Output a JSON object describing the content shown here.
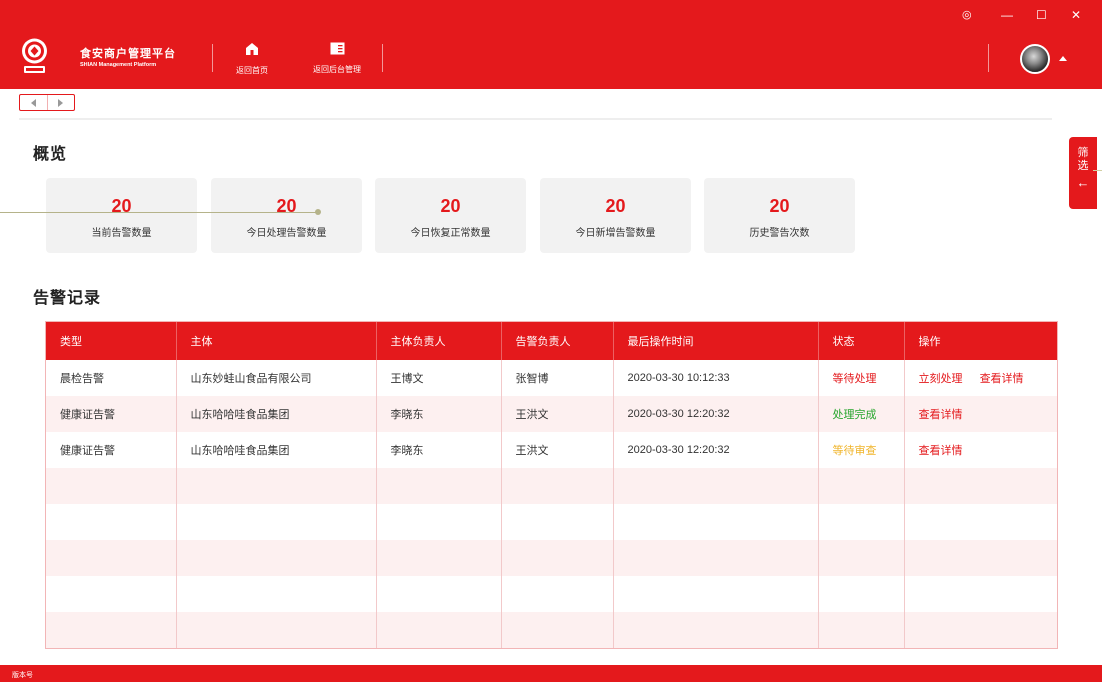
{
  "app": {
    "brand_cn": "食安商户管理平台",
    "brand_en": "SHIAN Management Platform",
    "brand_color": "#e4191c"
  },
  "nav": {
    "home_label": "返回首页",
    "home_icon": "home-icon",
    "admin_label": "返回后台管理",
    "admin_icon": "panel-icon"
  },
  "window": {
    "settings_icon": "◎",
    "minimize_icon": "—",
    "maximize_icon": "☐",
    "close_icon": "✕"
  },
  "overview": {
    "title": "概览",
    "cards": [
      {
        "value": "20",
        "label": "当前告警数量"
      },
      {
        "value": "20",
        "label": "今日处理告警数量"
      },
      {
        "value": "20",
        "label": "今日恢复正常数量"
      },
      {
        "value": "20",
        "label": "今日新增告警数量"
      },
      {
        "value": "20",
        "label": "历史警告次数"
      }
    ]
  },
  "filter": {
    "label": "筛选",
    "arrow": "←"
  },
  "alerts": {
    "title": "告警记录",
    "columns": [
      "类型",
      "主体",
      "主体负责人",
      "告警负责人",
      "最后操作时间",
      "状态",
      "操作"
    ],
    "rows": [
      {
        "type": "晨检告警",
        "subject": "山东妙蛙山食品有限公司",
        "subject_owner": "王博文",
        "alert_owner": "张智博",
        "time": "2020-03-30 10:12:33",
        "status": "等待处理",
        "status_kind": "wait",
        "actions": [
          "立刻处理",
          "查看详情"
        ]
      },
      {
        "type": "健康证告警",
        "subject": "山东哈哈哇食品集团",
        "subject_owner": "李晓东",
        "alert_owner": "王洪文",
        "time": "2020-03-30 12:20:32",
        "status": "处理完成",
        "status_kind": "done",
        "actions": [
          "查看详情"
        ]
      },
      {
        "type": "健康证告警",
        "subject": "山东哈哈哇食品集团",
        "subject_owner": "李晓东",
        "alert_owner": "王洪文",
        "time": "2020-03-30 12:20:32",
        "status": "等待审查",
        "status_kind": "review",
        "actions": [
          "查看详情"
        ]
      }
    ],
    "status_colors": {
      "wait": "#e4191c",
      "done": "#26a52c",
      "review": "#f0b52c"
    }
  },
  "footer": {
    "version_label": "版本号"
  }
}
